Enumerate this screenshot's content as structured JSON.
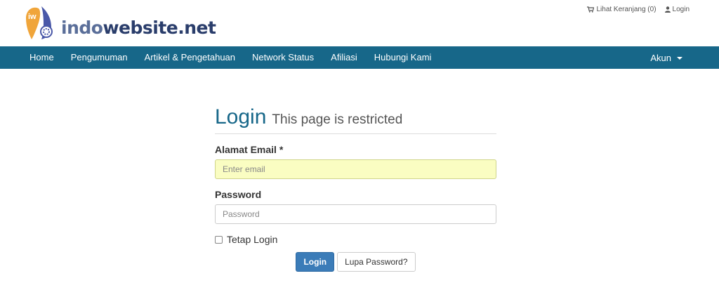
{
  "header": {
    "logo_badge": "iw",
    "logo_text_a": "indo",
    "logo_text_b": "website",
    "logo_text_c": ".net",
    "cart_label": "Lihat Keranjang (0)",
    "login_link": "Login"
  },
  "nav": {
    "items": [
      {
        "label": "Home"
      },
      {
        "label": "Pengumuman"
      },
      {
        "label": "Artikel & Pengetahuan"
      },
      {
        "label": "Network Status"
      },
      {
        "label": "Afiliasi"
      },
      {
        "label": "Hubungi Kami"
      }
    ],
    "account_label": "Akun"
  },
  "login": {
    "title": "Login",
    "subtitle": "This page is restricted",
    "email_label": "Alamat Email *",
    "email_placeholder": "Enter email",
    "password_label": "Password",
    "password_placeholder": "Password",
    "remember_label": "Tetap Login",
    "login_button": "Login",
    "forgot_button": "Lupa Password?"
  },
  "colors": {
    "nav_bg": "#176789",
    "primary_button": "#3b7cb8",
    "email_highlight": "#fafdc2",
    "logo_orange": "#f0a53a",
    "logo_blue": "#4a58a8"
  }
}
